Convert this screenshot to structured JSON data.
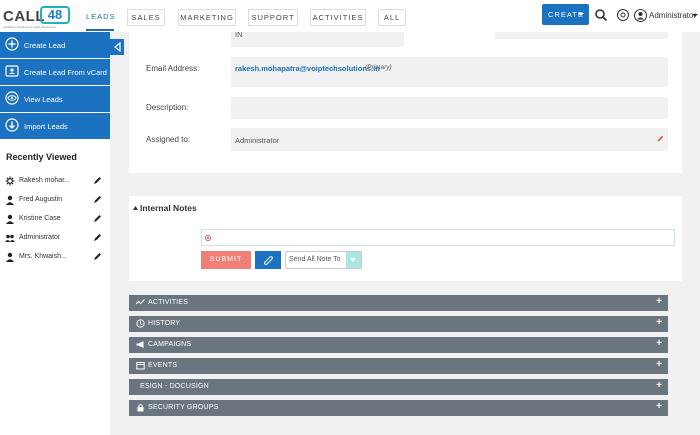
{
  "brand": {
    "logo_text_call": "CALL",
    "logo_text_48": "48",
    "tagline": "Intelligent Solutions for Next Generation"
  },
  "nav": {
    "tabs": [
      {
        "label": "LEADS"
      },
      {
        "label": "SALES"
      },
      {
        "label": "MARKETING"
      },
      {
        "label": "SUPPORT"
      },
      {
        "label": "ACTIVITIES"
      },
      {
        "label": "ALL"
      }
    ],
    "create_label": "CREATE",
    "user_name": "Administrator"
  },
  "sidebar": {
    "actions": [
      {
        "label": "Create Lead",
        "icon": "plus-circle-icon"
      },
      {
        "label": "Create Lead From vCard",
        "icon": "vcard-icon"
      },
      {
        "label": "View Leads",
        "icon": "eye-icon"
      },
      {
        "label": "Import Leads",
        "icon": "download-icon"
      }
    ],
    "recent_title": "Recently Viewed",
    "recent_items": [
      {
        "label": "Rakesh mohar...",
        "icon": "gear-icon"
      },
      {
        "label": "Fred Augustin",
        "icon": "person-icon"
      },
      {
        "label": "Kristine Case",
        "icon": "person-icon"
      },
      {
        "label": "Administrator",
        "icon": "group-icon"
      },
      {
        "label": "Mrs. Khwaish...",
        "icon": "person-icon"
      }
    ]
  },
  "detail": {
    "top_fragment": "IN",
    "email_label": "Email Address:",
    "email_value": "rakesh.mohapatra@voiptechsolutions.in",
    "email_tag": "(Primary)",
    "description_label": "Description:",
    "description_value": "",
    "assigned_label": "Assigned to:",
    "assigned_value": "Administrator"
  },
  "notes": {
    "title": "Internal Notes",
    "input_value": "",
    "submit_label": "SUBMIT",
    "send_select_value": "Send All Note To"
  },
  "subpanels": [
    {
      "label": "ACTIVITIES",
      "icon": "activity-icon"
    },
    {
      "label": "HISTORY",
      "icon": "history-icon"
    },
    {
      "label": "CAMPAIGNS",
      "icon": "megaphone-icon"
    },
    {
      "label": "EVENTS",
      "icon": "calendar-icon"
    },
    {
      "label": "ESIGN - DOCUSIGN",
      "icon": ""
    },
    {
      "label": "SECURITY GROUPS",
      "icon": "lock-icon"
    }
  ],
  "colors": {
    "primary": "#1a72c1",
    "subpanel_bar": "#6b7580",
    "submit": "#ef7f77",
    "link": "#1a6fb0"
  }
}
